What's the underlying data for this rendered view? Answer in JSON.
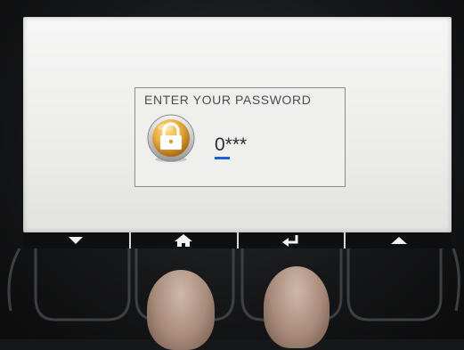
{
  "dialog": {
    "title": "ENTER YOUR PASSWORD",
    "password_display": "0***"
  },
  "icons": {
    "lock": "lock-icon",
    "softkeys": [
      "arrow-down-icon",
      "home-icon",
      "enter-icon",
      "arrow-up-icon"
    ]
  },
  "colors": {
    "screen_background": "#eeeeec",
    "cursor": "#1a5fd6",
    "lock_gold": "#e0a636",
    "softkey_bar": "#0e0f10"
  }
}
